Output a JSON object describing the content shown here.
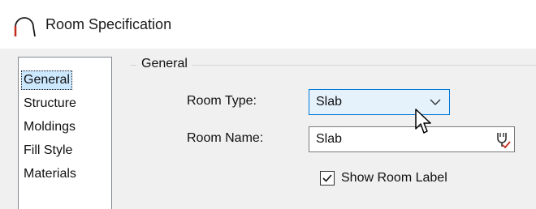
{
  "window": {
    "title": "Room Specification",
    "icon": "arch-icon",
    "accent_color": "#c42b1c"
  },
  "sidebar": {
    "items": [
      {
        "label": "General",
        "selected": true
      },
      {
        "label": "Structure",
        "selected": false
      },
      {
        "label": "Moldings",
        "selected": false
      },
      {
        "label": "Fill Style",
        "selected": false
      },
      {
        "label": "Materials",
        "selected": false
      }
    ]
  },
  "panel": {
    "group_title": "General",
    "room_type": {
      "label": "Room Type:",
      "value": "Slab"
    },
    "room_name": {
      "label": "Room Name:",
      "value": "Slab",
      "macro_icon": "text-macro-icon"
    },
    "show_room_label": {
      "label": "Show Room Label",
      "checked": true
    }
  },
  "cursor": {
    "icon": "mouse-pointer-icon"
  }
}
